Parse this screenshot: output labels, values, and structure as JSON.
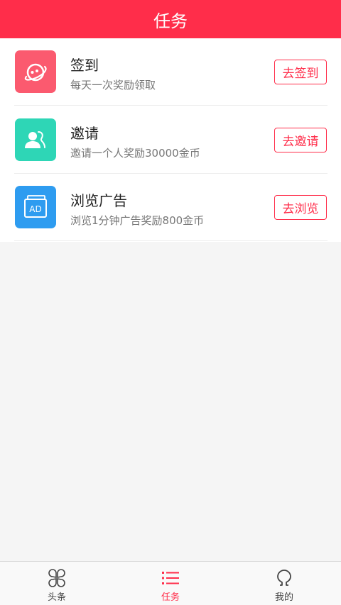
{
  "header": {
    "title": "任务"
  },
  "tasks": [
    {
      "title": "签到",
      "desc": "每天一次奖励领取",
      "button": "去签到",
      "icon": "planet-icon"
    },
    {
      "title": "邀请",
      "desc": "邀请一个人奖励30000金币",
      "button": "去邀请",
      "icon": "invite-users-icon"
    },
    {
      "title": "浏览广告",
      "desc": "浏览1分钟广告奖励800金币",
      "button": "去浏览",
      "icon": "ad-icon",
      "icon_text": "AD"
    }
  ],
  "tabbar": {
    "active": "任务",
    "tabs": [
      {
        "label": "头条",
        "icon": "clover-icon"
      },
      {
        "label": "任务",
        "icon": "list-icon"
      },
      {
        "label": "我的",
        "icon": "profile-icon"
      }
    ]
  },
  "colors": {
    "accent": "#ff2d4a",
    "signin": "#fb5a6f",
    "invite": "#2ed6b6",
    "ad": "#2e9cf0"
  }
}
